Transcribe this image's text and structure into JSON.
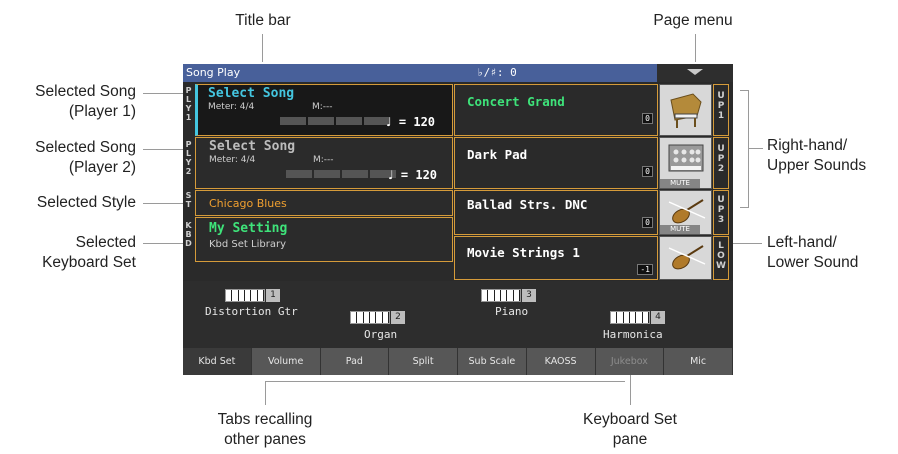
{
  "callouts": {
    "title_bar": "Title bar",
    "page_menu": "Page menu",
    "song_p1": [
      "Selected Song",
      "(Player 1)"
    ],
    "song_p2": [
      "Selected Song",
      "(Player 2)"
    ],
    "style": "Selected Style",
    "kbd_set": [
      "Selected",
      "Keyboard Set"
    ],
    "upper": [
      "Right-hand/",
      "Upper Sounds"
    ],
    "lower": [
      "Left-hand/",
      "Lower Sound"
    ],
    "tabs": [
      "Tabs recalling",
      "other panes"
    ],
    "kbd_pane": [
      "Keyboard Set",
      "pane"
    ]
  },
  "screen": {
    "title": "Song Play",
    "key": "♭/♯: 0",
    "song1": {
      "tag": [
        "P",
        "L",
        "Y",
        "1"
      ],
      "title": "Select Song",
      "meter": "Meter: 4/4",
      "measure": "M:---",
      "tempo": "= 120",
      "note": "♩"
    },
    "song2": {
      "tag": [
        "P",
        "L",
        "Y",
        "2"
      ],
      "title": "Select Song",
      "meter": "Meter: 4/4",
      "measure": "M:---",
      "tempo": "= 120",
      "note": "♩"
    },
    "style": {
      "tag": [
        "S",
        "T"
      ],
      "name": "Chicago Blues"
    },
    "kbd": {
      "tag": [
        "K",
        "B",
        "D"
      ],
      "name": "My Setting",
      "library": "Kbd Set Library"
    },
    "sounds": [
      {
        "name": "Concert Grand",
        "badge": "0",
        "tag": [
          "U",
          "P",
          "1"
        ],
        "icon": "grand-piano-icon",
        "mute": ""
      },
      {
        "name": "Dark Pad",
        "badge": "0",
        "tag": [
          "U",
          "P",
          "2"
        ],
        "icon": "synth-pad-icon",
        "mute": "MUTE"
      },
      {
        "name": "Ballad Strs. DNC",
        "badge": "0",
        "tag": [
          "U",
          "P",
          "3"
        ],
        "icon": "violin-icon",
        "mute": "MUTE"
      },
      {
        "name": "Movie Strings 1",
        "badge": "-1",
        "tag": [
          "L",
          "O",
          "W"
        ],
        "icon": "violin-icon",
        "mute": ""
      }
    ],
    "keyboard_sets": [
      {
        "num": "1",
        "name": "Distortion Gtr"
      },
      {
        "num": "2",
        "name": "Organ"
      },
      {
        "num": "3",
        "name": "Piano"
      },
      {
        "num": "4",
        "name": "Harmonica"
      }
    ],
    "tabs": [
      "Kbd Set",
      "Volume",
      "Pad",
      "Split",
      "Sub Scale",
      "KAOSS",
      "Jukebox",
      "Mic"
    ]
  },
  "colors": {
    "accent_cyan": "#44c6e0",
    "accent_green": "#3ee37a",
    "accent_orange": "#f0a030",
    "border_orange": "#d59b3a",
    "title_blue": "#48609a"
  }
}
